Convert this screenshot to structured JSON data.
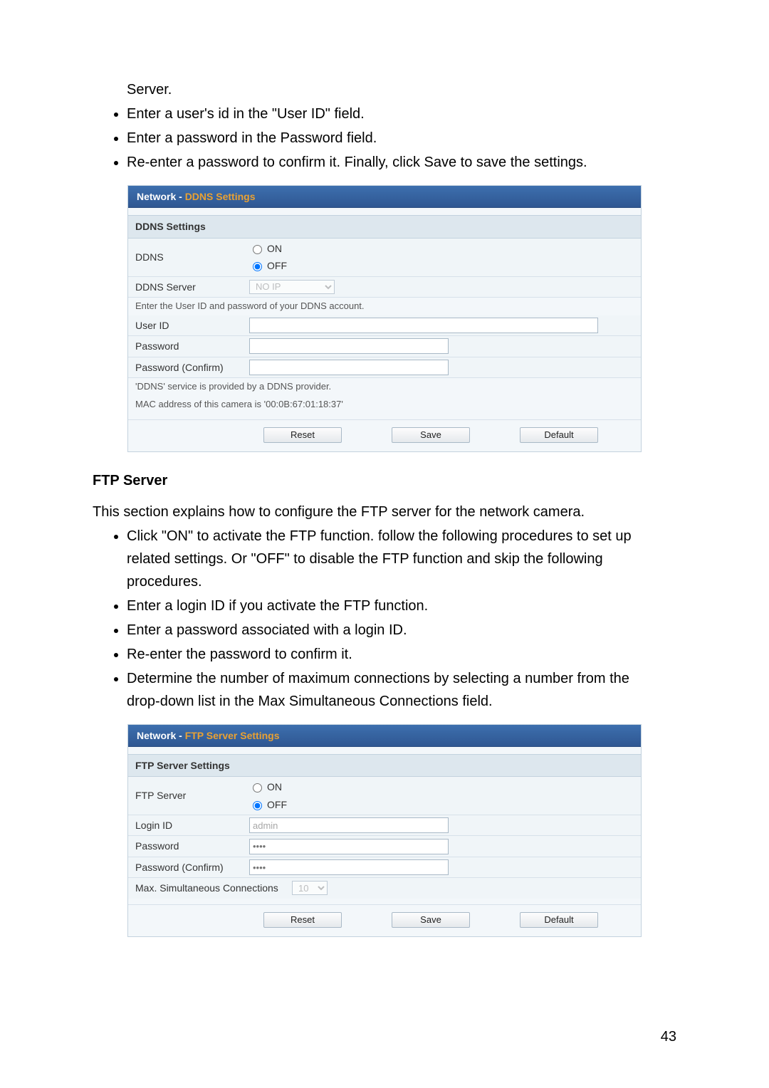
{
  "intro_lines": {
    "server": "Server.",
    "li1": "Enter a user's id in the \"User ID\" field.",
    "li2": "Enter a password in the Password field.",
    "li3": "Re-enter a password to confirm it. Finally, click Save to save the settings."
  },
  "panel_ddns": {
    "title_prefix": "Network  - ",
    "title_main": "DDNS Settings",
    "subheader": "DDNS Settings",
    "row_ddns_label": "DDNS",
    "on": "ON",
    "off": "OFF",
    "row_server_label": "DDNS Server",
    "server_value": "NO IP",
    "help1": "Enter the User ID and password of your DDNS account.",
    "row_user_label": "User ID",
    "row_pw_label": "Password",
    "row_pwc_label": "Password (Confirm)",
    "help2": "'DDNS' service is provided by a DDNS provider.",
    "help3": "MAC address of this camera is '00:0B:67:01:18:37'",
    "btn_reset": "Reset",
    "btn_save": "Save",
    "btn_default": "Default"
  },
  "ftp_heading": "FTP Server",
  "ftp_intro": "This section explains how to configure the FTP server for the network camera.",
  "ftp_li": {
    "a1": "Click \"ON\" to activate the FTP function. follow the following procedures to set up",
    "a2": "related settings. Or \"OFF\" to disable the FTP function and skip the following",
    "a3": "procedures.",
    "b": "Enter a login ID if you activate the FTP function.",
    "c": "Enter a password associated with a login ID.",
    "d": "Re-enter the password to confirm it.",
    "e1": "Determine the number of maximum connections by selecting a number from the",
    "e2": "drop-down list in the Max Simultaneous Connections field."
  },
  "panel_ftp": {
    "title_prefix": "Network  - ",
    "title_main": "FTP Server Settings",
    "subheader": "FTP Server Settings",
    "row_server_label": "FTP Server",
    "on": "ON",
    "off": "OFF",
    "row_login_label": "Login ID",
    "login_value": "admin",
    "row_pw_label": "Password",
    "row_pwc_label": "Password (Confirm)",
    "pw_placeholder": "••••",
    "row_max_label": "Max. Simultaneous Connections",
    "max_value": "10",
    "btn_reset": "Reset",
    "btn_save": "Save",
    "btn_default": "Default"
  },
  "page_number": "43"
}
